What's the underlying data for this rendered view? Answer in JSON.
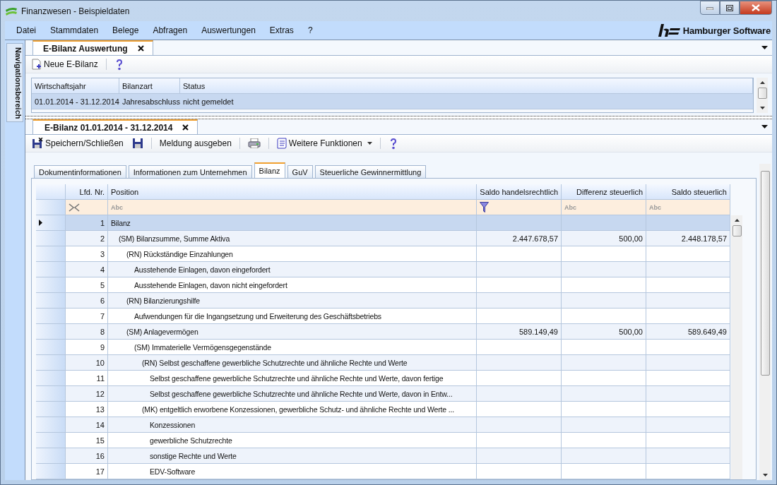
{
  "window": {
    "title": "Finanzwesen - Beispieldaten"
  },
  "menu": [
    "Datei",
    "Stammdaten",
    "Belege",
    "Abfragen",
    "Auswertungen",
    "Extras",
    "?"
  ],
  "brand": "Hamburger Software",
  "navigation": "Navigationsbereich",
  "top_pane": {
    "tab": {
      "label": "E-Bilanz Auswertung",
      "selected": true
    },
    "toolbar": [
      {
        "kind": "new",
        "label": "Neue E-Bilanz"
      },
      {
        "kind": "help"
      }
    ],
    "columns": [
      "Wirtschaftsjahr",
      "Bilanzart",
      "Status"
    ],
    "rows": [
      {
        "selected": true,
        "cells": [
          "01.01.2014 - 31.12.2014",
          "Jahresabschluss",
          "nicht gemeldet"
        ]
      }
    ]
  },
  "bottom_pane": {
    "tab": {
      "label": "E-Bilanz 01.01.2014 - 31.12.2014",
      "selected": true
    },
    "toolbar": [
      {
        "kind": "saveclose",
        "label": "Speichern/Schließen"
      },
      {
        "kind": "save"
      },
      {
        "kind": "sep"
      },
      {
        "kind": "text",
        "label": "Meldung ausgeben"
      },
      {
        "kind": "sep"
      },
      {
        "kind": "print"
      },
      {
        "kind": "sep"
      },
      {
        "kind": "menu",
        "label": "Weitere Funktionen"
      },
      {
        "kind": "sep"
      },
      {
        "kind": "help"
      }
    ],
    "tabs": [
      {
        "label": "Dokumentinformationen",
        "selected": false
      },
      {
        "label": "Informationen zum Unternehmen",
        "selected": false
      },
      {
        "label": "Bilanz",
        "selected": true
      },
      {
        "label": "GuV",
        "selected": false
      },
      {
        "label": "Steuerliche Gewinnermittlung",
        "selected": false
      }
    ],
    "columns": [
      "Lfd. Nr.",
      "Position",
      "Saldo handelsrechtlich",
      "Differenz steuerlich",
      "Saldo steuerlich"
    ],
    "filters": [
      {
        "kind": "clear"
      },
      {
        "kind": "text",
        "text": "Abc"
      },
      {
        "kind": "funnel"
      },
      {
        "kind": "text",
        "text": "Abc"
      },
      {
        "kind": "text",
        "text": "Abc"
      }
    ],
    "rows": [
      {
        "nr": "1",
        "position": "Bilanz",
        "selected": true,
        "children": [
          {
            "nr": "2",
            "position": "(SM) Bilanzsumme, Summe Aktiva",
            "saldo_hr": "2.447.678,57",
            "differenz": "500,00",
            "saldo_st": "2.448.178,57",
            "selected": false,
            "children": [
              {
                "nr": "3",
                "position": "(RN) Rückständige Einzahlungen",
                "selected": false,
                "children": [
                  {
                    "nr": "4",
                    "position": "Ausstehende Einlagen, davon eingefordert",
                    "selected": false
                  },
                  {
                    "nr": "5",
                    "position": "Ausstehende Einlagen, davon nicht eingefordert",
                    "selected": false
                  }
                ]
              },
              {
                "nr": "6",
                "position": "(RN) Bilanzierungshilfe",
                "selected": false,
                "children": [
                  {
                    "nr": "7",
                    "position": "Aufwendungen für die Ingangsetzung und Erweiterung des Geschäftsbetriebs",
                    "selected": false
                  }
                ]
              },
              {
                "nr": "8",
                "position": "(SM) Anlagevermögen",
                "saldo_hr": "589.149,49",
                "differenz": "500,00",
                "saldo_st": "589.649,49",
                "selected": false,
                "children": [
                  {
                    "nr": "9",
                    "position": "(SM) Immaterielle Vermögensgegenstände",
                    "selected": false,
                    "children": [
                      {
                        "nr": "10",
                        "position": "(RN) Selbst geschaffene gewerbliche Schutzrechte und ähnliche Rechte und Werte",
                        "selected": false,
                        "children": [
                          {
                            "nr": "11",
                            "position": "Selbst geschaffene gewerbliche Schutzrechte und ähnliche Rechte und Werte, davon fertige",
                            "selected": false
                          },
                          {
                            "nr": "12",
                            "position": "Selbst geschaffene gewerbliche Schutzrechte und ähnliche Rechte und Werte, davon in Entw...",
                            "selected": false
                          }
                        ]
                      },
                      {
                        "nr": "13",
                        "position": "(MK) entgeltlich erworbene Konzessionen, gewerbliche Schutz- und ähnliche Rechte und Werte ...",
                        "selected": false,
                        "children": [
                          {
                            "nr": "14",
                            "position": "Konzessionen",
                            "selected": false
                          },
                          {
                            "nr": "15",
                            "position": "gewerbliche Schutzrechte",
                            "selected": false
                          },
                          {
                            "nr": "16",
                            "position": "sonstige Rechte und Werte",
                            "selected": false
                          },
                          {
                            "nr": "17",
                            "position": "EDV-Software",
                            "selected": false
                          }
                        ]
                      }
                    ]
                  }
                ]
              }
            ]
          }
        ]
      }
    ]
  }
}
